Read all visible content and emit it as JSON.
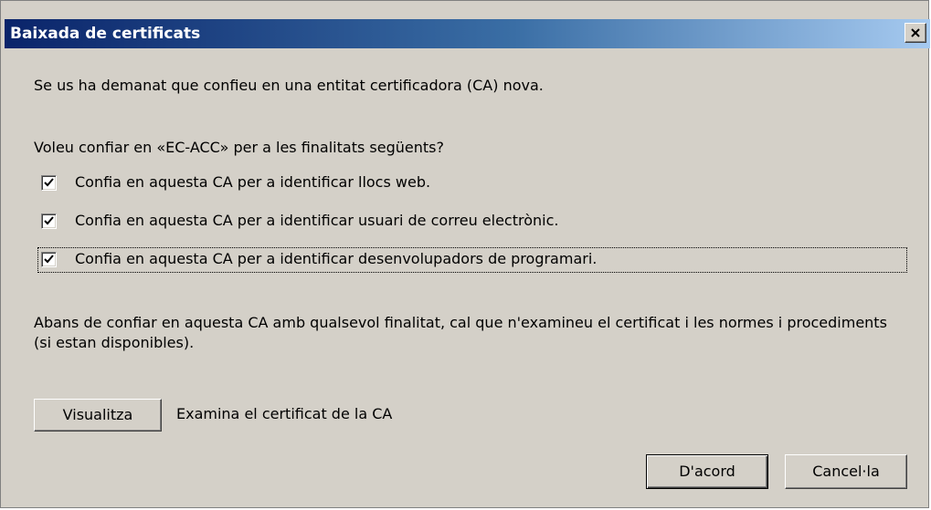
{
  "window": {
    "title": "Baixada de certificats"
  },
  "dialog": {
    "intro": "Se us ha demanat que confieu en una entitat certificadora (CA) nova.",
    "question": "Voleu confiar en «EC-ACC» per a les finalitats següents?",
    "checkboxes": [
      {
        "label": "Confia en aquesta CA per a identificar llocs web.",
        "checked": true
      },
      {
        "label": "Confia en aquesta CA per a identificar usuari de correu electrònic.",
        "checked": true
      },
      {
        "label": "Confia en aquesta CA per a identificar desenvolupadors de programari.",
        "checked": true
      }
    ],
    "advice": "Abans de confiar en aquesta CA amb qualsevol finalitat, cal que n'examineu el certificat i les normes i procediments (si estan disponibles).",
    "view_button": "Visualitza",
    "view_description": "Examina el certificat de la CA",
    "ok_button": "D'acord",
    "cancel_button": "Cancel·la"
  }
}
